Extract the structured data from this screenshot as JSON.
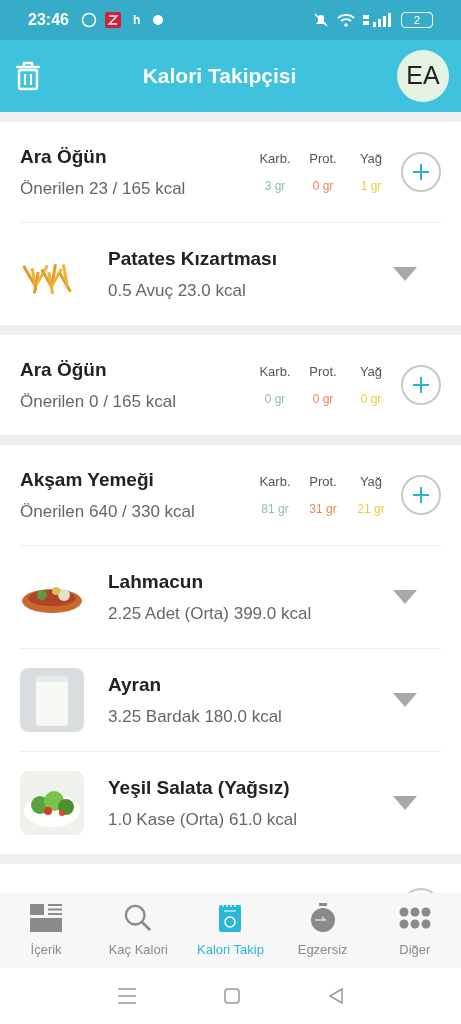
{
  "status_bar": {
    "time": "23:46",
    "notification_letter": "h",
    "battery": "2"
  },
  "header": {
    "title": "Kalori Takipçisi",
    "avatar": "EA"
  },
  "meals": [
    {
      "title": "Ara Öğün",
      "summary": "Önerilen 23 / 165 kcal",
      "macros": [
        {
          "label": "Karb.",
          "value": "3 gr",
          "color": "#8fbcb2"
        },
        {
          "label": "Prot.",
          "value": "0 gr",
          "color": "#f0845a"
        },
        {
          "label": "Yağ",
          "value": "1 gr",
          "color": "#e9cf3c"
        }
      ],
      "foods": [
        {
          "name": "Patates Kızartması",
          "detail": "0.5 Avuç 23.0 kcal",
          "kind": "fries"
        }
      ]
    },
    {
      "title": "Ara Öğün",
      "summary": "Önerilen 0 / 165 kcal",
      "macros": [
        {
          "label": "Karb.",
          "value": "0 gr",
          "color": "#8fbcb2"
        },
        {
          "label": "Prot.",
          "value": "0 gr",
          "color": "#f0845a"
        },
        {
          "label": "Yağ",
          "value": "0 gr",
          "color": "#e9cf3c"
        }
      ]
    },
    {
      "title": "Akşam Yemeği",
      "summary": "Önerilen 640 / 330 kcal",
      "macros": [
        {
          "label": "Karb.",
          "value": "81 gr",
          "color": "#8fbcb2"
        },
        {
          "label": "Prot.",
          "value": "31 gr",
          "color": "#f0845a"
        },
        {
          "label": "Yağ",
          "value": "21 gr",
          "color": "#e9cf3c"
        }
      ],
      "foods": [
        {
          "name": "Lahmacun",
          "detail": "2.25 Adet (Orta) 399.0 kcal",
          "kind": "flatbread"
        },
        {
          "name": "Ayran",
          "detail": "3.25 Bardak 180.0 kcal",
          "kind": "drink"
        },
        {
          "name": "Yeşil Salata (Yağsız)",
          "detail": "1.0 Kase (Orta) 61.0 kcal",
          "kind": "salad"
        }
      ]
    }
  ],
  "bottom_nav": [
    {
      "label": "İçerik",
      "selected": false
    },
    {
      "label": "Kaç Kalori",
      "selected": false
    },
    {
      "label": "Kalori Takip",
      "selected": true
    },
    {
      "label": "Egzersiz",
      "selected": false
    },
    {
      "label": "Diğer",
      "selected": false
    }
  ]
}
